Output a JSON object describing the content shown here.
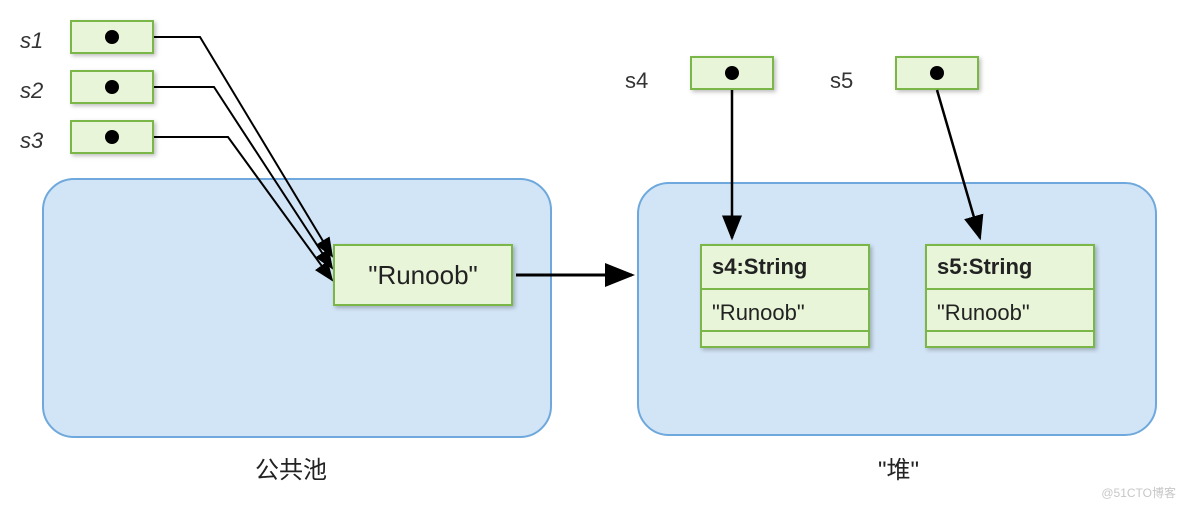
{
  "refs": {
    "s1": "s1",
    "s2": "s2",
    "s3": "s3",
    "s4": "s4",
    "s5": "s5"
  },
  "pool": {
    "literal": "\"Runoob\"",
    "caption": "公共池"
  },
  "heap": {
    "caption": "\"堆\"",
    "objects": {
      "s4": {
        "header": "s4:String",
        "value": "\"Runoob\""
      },
      "s5": {
        "header": "s5:String",
        "value": "\"Runoob\""
      }
    }
  },
  "watermark": "@51CTO博客",
  "colors": {
    "box_fill": "#e8f5d8",
    "box_border": "#7ab648",
    "container_fill": "#d2e5f6",
    "container_border": "#6ea8dc"
  }
}
